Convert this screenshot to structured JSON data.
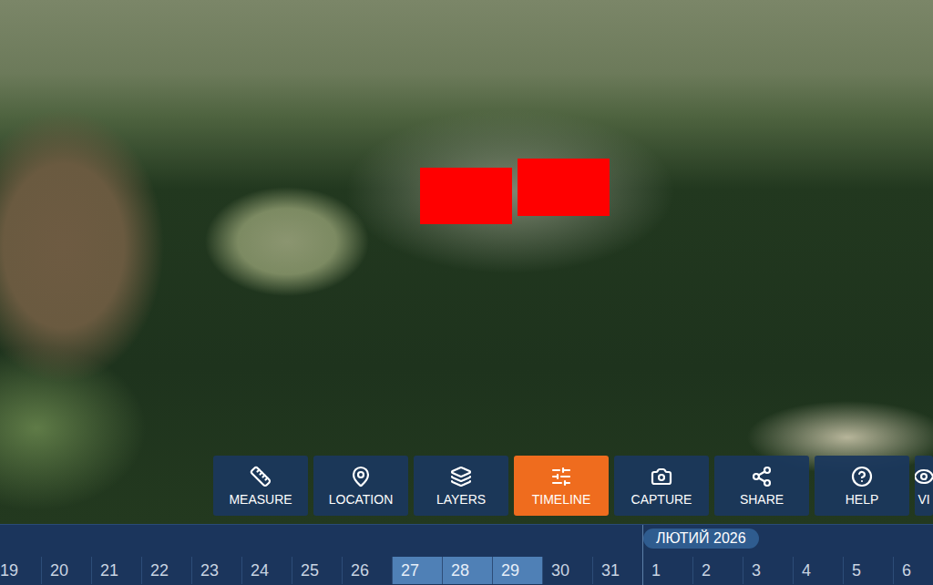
{
  "toolbar": {
    "buttons": [
      {
        "label": "MEASURE",
        "selected": false
      },
      {
        "label": "LOCATION",
        "selected": false
      },
      {
        "label": "LAYERS",
        "selected": false
      },
      {
        "label": "TIMELINE",
        "selected": true
      },
      {
        "label": "CAPTURE",
        "selected": false
      },
      {
        "label": "SHARE",
        "selected": false
      },
      {
        "label": "HELP",
        "selected": false
      },
      {
        "label": "VI",
        "selected": false
      }
    ]
  },
  "timeline": {
    "months": [
      {
        "days": [
          {
            "day": "19",
            "selected": false
          },
          {
            "day": "20",
            "selected": false
          },
          {
            "day": "21",
            "selected": false
          },
          {
            "day": "22",
            "selected": false
          },
          {
            "day": "23",
            "selected": false
          },
          {
            "day": "24",
            "selected": false
          },
          {
            "day": "25",
            "selected": false
          },
          {
            "day": "26",
            "selected": false
          },
          {
            "day": "27",
            "selected": true
          },
          {
            "day": "28",
            "selected": true
          },
          {
            "day": "29",
            "selected": true
          },
          {
            "day": "30",
            "selected": false
          },
          {
            "day": "31",
            "selected": false
          }
        ]
      },
      {
        "label": "ЛЮТИЙ 2026",
        "days": [
          {
            "day": "1",
            "selected": false
          },
          {
            "day": "2",
            "selected": false
          },
          {
            "day": "3",
            "selected": false
          },
          {
            "day": "4",
            "selected": false
          },
          {
            "day": "5",
            "selected": false
          },
          {
            "day": "6",
            "selected": false
          }
        ]
      }
    ]
  }
}
